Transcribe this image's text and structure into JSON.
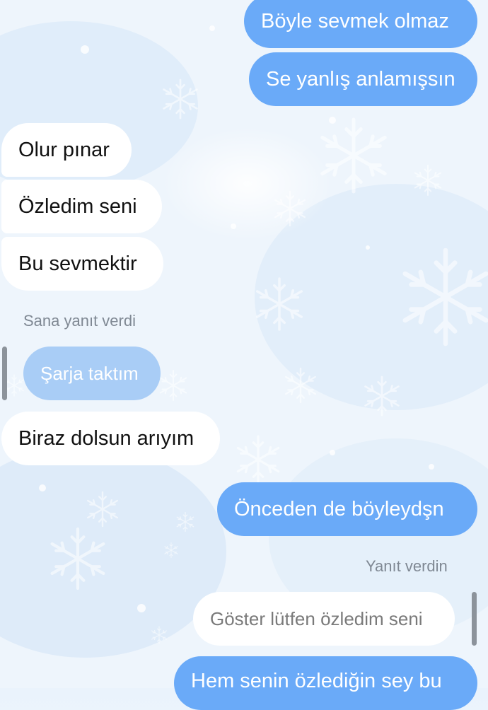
{
  "colors": {
    "outgoing_bubble": "#6aaaf8",
    "incoming_bubble": "#ffffff",
    "quoted_incoming_bubble": "#a9cdf6",
    "meta_text": "#7f8893"
  },
  "background": {
    "pattern_icon": "snowflake-icon"
  },
  "messages": {
    "m1": "Böyle sevmek olmaz",
    "m2": "Se yanlış anlamışsın",
    "m3": "Olur pınar",
    "m4": "Özledim seni",
    "m5": "Bu sevmektir",
    "reply_label_in": "Sana yanıt verdi",
    "quote_in": "Şarja taktım",
    "m6": "Biraz dolsun arıyım",
    "m7": "Önceden de böyleydşn",
    "reply_label_out": "Yanıt verdin",
    "quote_out": "Göster lütfen özledim seni",
    "m8": "Hem senin özlediğin sey bu"
  }
}
